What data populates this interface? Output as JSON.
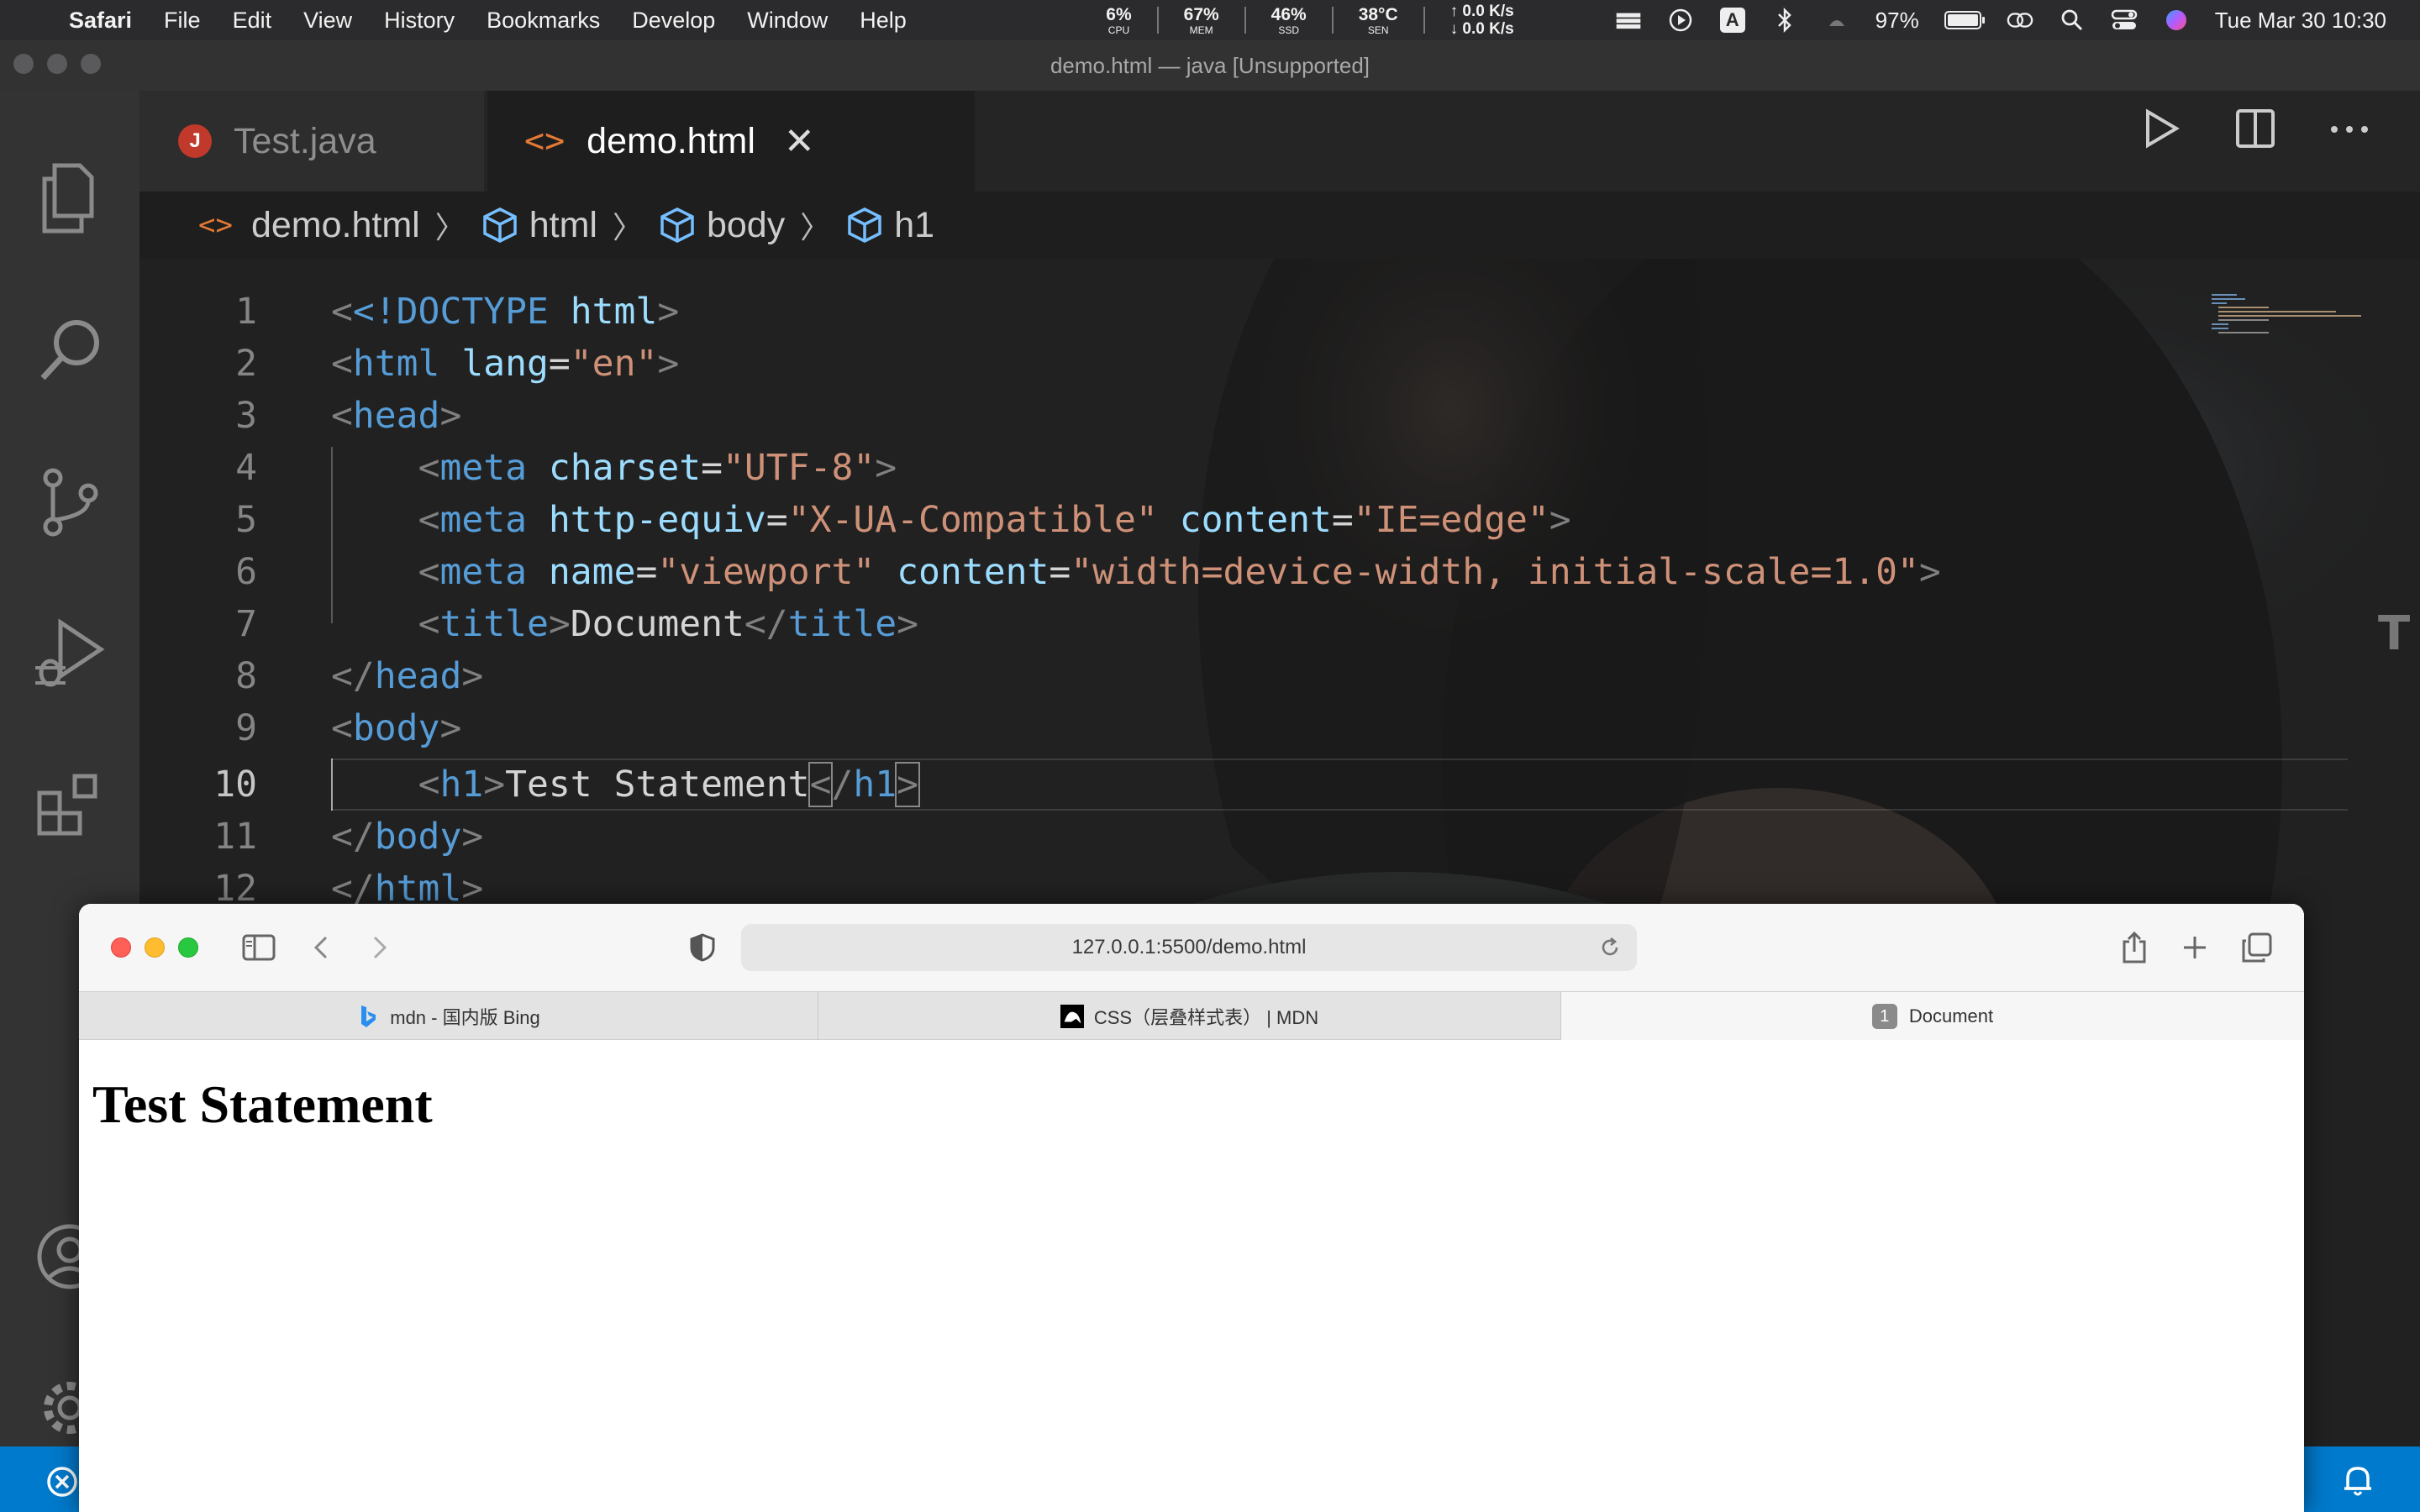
{
  "menubar": {
    "app_name": "Safari",
    "menus": [
      "File",
      "Edit",
      "View",
      "History",
      "Bookmarks",
      "Develop",
      "Window",
      "Help"
    ],
    "stats": {
      "cpu_value": "6%",
      "cpu_label": "CPU",
      "mem_value": "67%",
      "mem_label": "MEM",
      "ssd_value": "46%",
      "ssd_label": "SSD",
      "sen_value": "38°C",
      "sen_label": "SEN",
      "net_up": "↑ 0.0 K/s",
      "net_down": "↓ 0.0 K/s"
    },
    "battery_percent": "97%",
    "input_source": "A",
    "clock": "Tue Mar 30  10:30"
  },
  "vscode": {
    "window_title": "demo.html — java [Unsupported]",
    "tabs": [
      {
        "label": "Test.java",
        "badge": "J"
      },
      {
        "label": "demo.html",
        "glyph": "<>"
      }
    ],
    "breadcrumbs": [
      "demo.html",
      "html",
      "body",
      "h1"
    ],
    "current_line": 10,
    "code_lines": [
      {
        "n": "1"
      },
      {
        "n": "2"
      },
      {
        "n": "3"
      },
      {
        "n": "4"
      },
      {
        "n": "5"
      },
      {
        "n": "6"
      },
      {
        "n": "7"
      },
      {
        "n": "8"
      },
      {
        "n": "9"
      },
      {
        "n": "10"
      },
      {
        "n": "11"
      },
      {
        "n": "12"
      }
    ],
    "code": {
      "l1_decl": "<!DOCTYPE",
      "l1_name": "html",
      "l2_tag": "html",
      "l2_attr": "lang",
      "l2_val": "\"en\"",
      "l3_tag": "head",
      "l4_tag": "meta",
      "l4_attr": "charset",
      "l4_val": "\"UTF-8\"",
      "l5_tag": "meta",
      "l5_attr1": "http-equiv",
      "l5_val1": "\"X-UA-Compatible\"",
      "l5_attr2": "content",
      "l5_val2": "\"IE=edge\"",
      "l6_tag": "meta",
      "l6_attr1": "name",
      "l6_val1": "\"viewport\"",
      "l6_attr2": "content",
      "l6_val2": "\"width=device-width, initial-scale=1.0\"",
      "l7_tag": "title",
      "l7_text": "Document",
      "l8_tag": "head",
      "l9_tag": "body",
      "l10_tag": "h1",
      "l10_text": "Test Statement",
      "l11_tag": "body",
      "l12_tag": "html"
    }
  },
  "safari": {
    "url": "127.0.0.1:5500/demo.html",
    "tabs": [
      {
        "label": "mdn - 国内版 Bing"
      },
      {
        "label": "CSS（层叠样式表） | MDN"
      },
      {
        "label": "Document",
        "badge": "1"
      }
    ],
    "page": {
      "heading": "Test Statement"
    }
  },
  "colors": {
    "vscode_accent": "#007acc",
    "html_tag": "#569cd6",
    "html_attr": "#9cdcfe",
    "html_string": "#ce9178",
    "java_badge": "#c0392b",
    "html_icon": "#e37933"
  }
}
